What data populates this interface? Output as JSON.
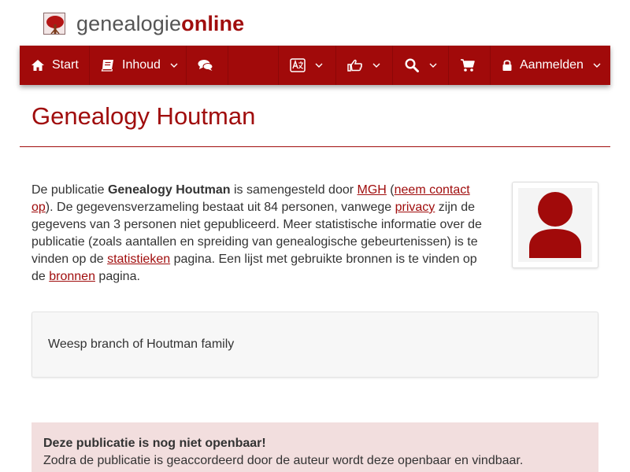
{
  "header": {
    "logo_part1": "genealogie",
    "logo_part2": "online"
  },
  "navbar": {
    "start_label": "Start",
    "inhoud_label": "Inhoud",
    "login_label": "Aanmelden"
  },
  "page": {
    "title": "Genealogy Houtman"
  },
  "intro": {
    "t1": "De publicatie ",
    "pub_name": "Genealogy Houtman",
    "t2": " is samengesteld door ",
    "author_link": "MGH",
    "t3": " (",
    "contact_link": "neem contact op",
    "t4": "). De gegevensverzameling bestaat uit 84 personen, vanwege ",
    "privacy_link": "privacy",
    "t5": " zijn de gegevens van 3 personen niet gepubliceerd. Meer statistische informatie over de publicatie (zoals aantallen en spreiding van genealogische gebeurtenissen) is te vinden op de ",
    "stats_link": "statistieken",
    "t6": " pagina. Een lijst met gebruikte bronnen is te vinden op de ",
    "sources_link": "bronnen",
    "t7": " pagina."
  },
  "description": {
    "text": "Weesp branch of Houtman family"
  },
  "alert": {
    "title": "Deze publicatie is nog niet openbaar!",
    "body": "Zodra de publicatie is geaccordeerd door de auteur wordt deze openbaar en vindbaar."
  },
  "colors": {
    "brand": "#a10a0a",
    "alert_bg": "#f2dede"
  },
  "icons": [
    "home-icon",
    "book-icon",
    "comments-icon",
    "language-icon",
    "thumbs-up-icon",
    "search-icon",
    "cart-icon",
    "lock-icon"
  ]
}
